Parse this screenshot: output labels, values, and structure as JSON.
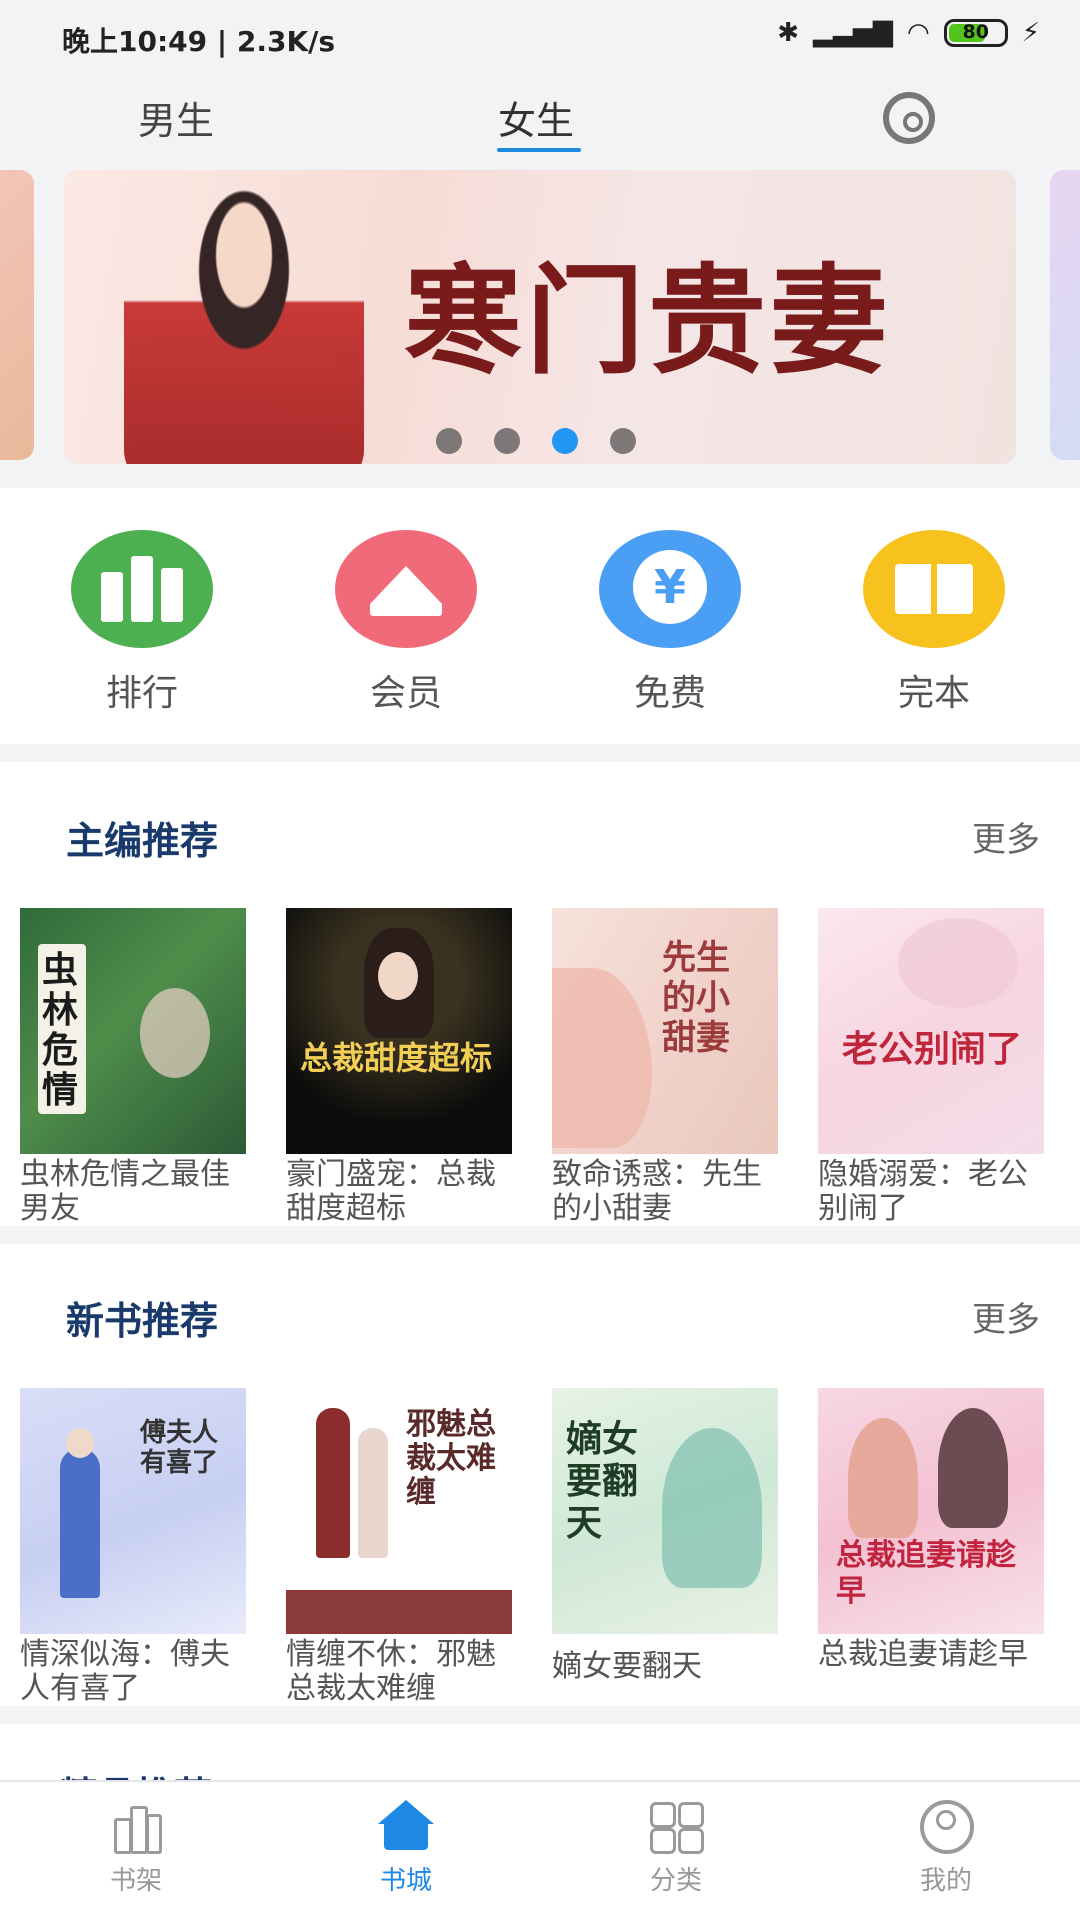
{
  "status_bar": {
    "time": "晚上10:49 | 2.3K/s",
    "battery": "80"
  },
  "top_tabs": [
    {
      "label": "男生"
    },
    {
      "label": "女生"
    }
  ],
  "banner": {
    "title": "寒门贵妻",
    "dot_count": 4,
    "active_dot": 2
  },
  "quick_entries": [
    {
      "label": "排行",
      "color": "#4caf50",
      "icon": "bar-chart-icon"
    },
    {
      "label": "会员",
      "color": "#f06a7a",
      "icon": "crown-icon"
    },
    {
      "label": "免费",
      "color": "#4a9ff5",
      "icon": "yen-icon"
    },
    {
      "label": "完本",
      "color": "#f7c21d",
      "icon": "book-icon"
    }
  ],
  "editor_picks": {
    "title": "主编推荐",
    "more": "更多",
    "books": [
      {
        "title": "虫林危情之最佳男友",
        "cover_text": "虫林危情"
      },
      {
        "title": "豪门盛宠：总裁甜度超标",
        "cover_text": "总裁甜度超标"
      },
      {
        "title": "致命诱惑：先生的小甜妻",
        "cover_text": "先生的小甜妻"
      },
      {
        "title": "隐婚溺爱：老公别闹了",
        "cover_text": "老公别闹了"
      }
    ]
  },
  "new_books": {
    "title": "新书推荐",
    "more": "更多",
    "books": [
      {
        "title": "情深似海：傅夫人有喜了",
        "cover_text": "傅夫人有喜了"
      },
      {
        "title": "情缠不休：邪魅总裁太难缠",
        "cover_text": "邪魅总裁太难缠"
      },
      {
        "title": "嫡女要翻天",
        "cover_text": "嫡女要翻天"
      },
      {
        "title": "总裁追妻请趁早",
        "cover_text": "总裁追妻请趁早"
      }
    ]
  },
  "next_section_partial": "精品推荐",
  "bottom_nav": [
    {
      "label": "书架",
      "icon": "bookshelf-icon"
    },
    {
      "label": "书城",
      "icon": "home-icon",
      "active": true
    },
    {
      "label": "分类",
      "icon": "grid-icon"
    },
    {
      "label": "我的",
      "icon": "user-icon"
    }
  ]
}
